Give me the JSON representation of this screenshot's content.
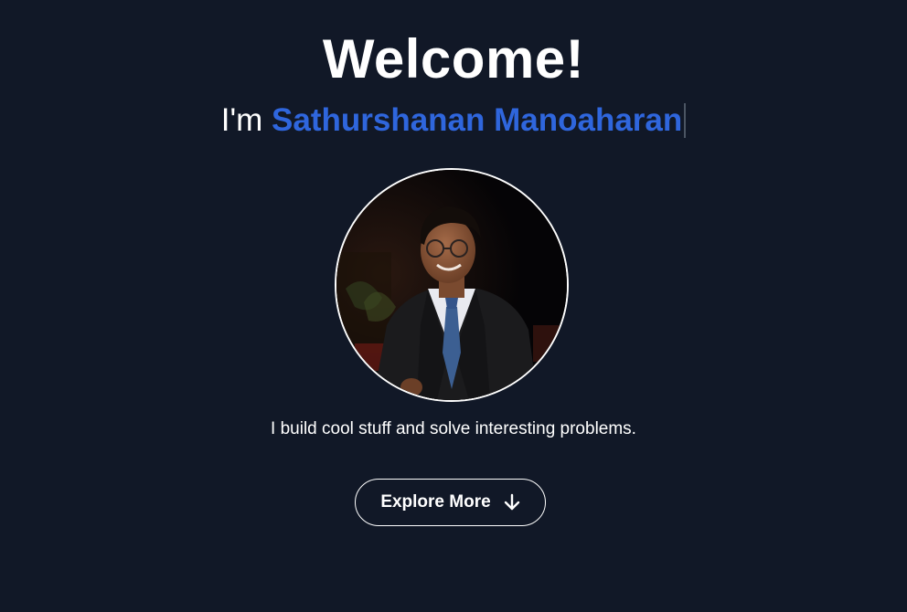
{
  "hero": {
    "title": "Welcome!",
    "intro_prefix": "I'm ",
    "name": "Sathurshanan Manoaharan",
    "tagline": "I build cool stuff and solve interesting problems.",
    "cta_label": "Explore More",
    "cta_icon": "arrow-down-icon",
    "avatar_alt": "Sathurshanan Manoaharan"
  },
  "colors": {
    "background": "#111827",
    "accent": "#2f66dd",
    "text": "#ffffff"
  }
}
